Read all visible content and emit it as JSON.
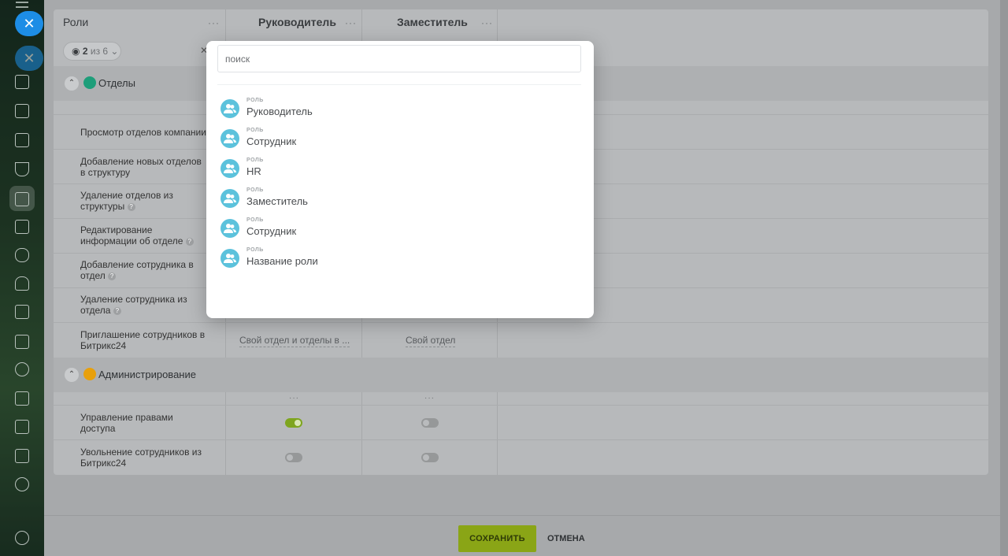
{
  "popup": {
    "search_placeholder": "поиск",
    "items": [
      {
        "caption": "РОЛЬ",
        "name": "Руководитель"
      },
      {
        "caption": "РОЛЬ",
        "name": "Сотрудник"
      },
      {
        "caption": "РОЛЬ",
        "name": "HR"
      },
      {
        "caption": "РОЛЬ",
        "name": "Заместитель"
      },
      {
        "caption": "РОЛЬ",
        "name": "Сотрудник"
      },
      {
        "caption": "РОЛЬ",
        "name": "Название роли"
      }
    ]
  },
  "table": {
    "roles_header": "Роли",
    "columns": [
      "Руководитель",
      "Заместитель"
    ],
    "dots": "···",
    "filter": {
      "count": "2",
      "of_text": "из 6"
    },
    "sections": [
      {
        "label": "Отделы",
        "color": "#1e9e7a",
        "rows": [
          {
            "label": "Просмотр отделов компании"
          },
          {
            "label": "Добавление новых отделов в структуру"
          },
          {
            "label": "Удаление отделов из структуры"
          },
          {
            "label": "Редактирование информации об отделе"
          },
          {
            "label": "Добавление сотрудника в отдел"
          },
          {
            "label": "Удаление сотрудника из отдела"
          },
          {
            "label": "Приглашение сотрудников в Битрикс24",
            "values": [
              "Свой отдел и отделы в ...",
              "Свой отдел"
            ]
          }
        ]
      },
      {
        "label": "Администрирование",
        "color": "#e8a00c",
        "rows": [
          {
            "label": "Управление правами доступа",
            "toggles": [
              true,
              false
            ]
          },
          {
            "label": "Увольнение сотрудников из Битрикс24",
            "toggles": [
              false,
              false
            ]
          }
        ]
      }
    ]
  },
  "footer": {
    "save_label": "СОХРАНИТЬ",
    "cancel_label": "ОТМЕНА"
  },
  "colors": {
    "accent": "#8aa516",
    "role_avatar": "#5cc2dc",
    "close_button": "#1d8de6"
  }
}
